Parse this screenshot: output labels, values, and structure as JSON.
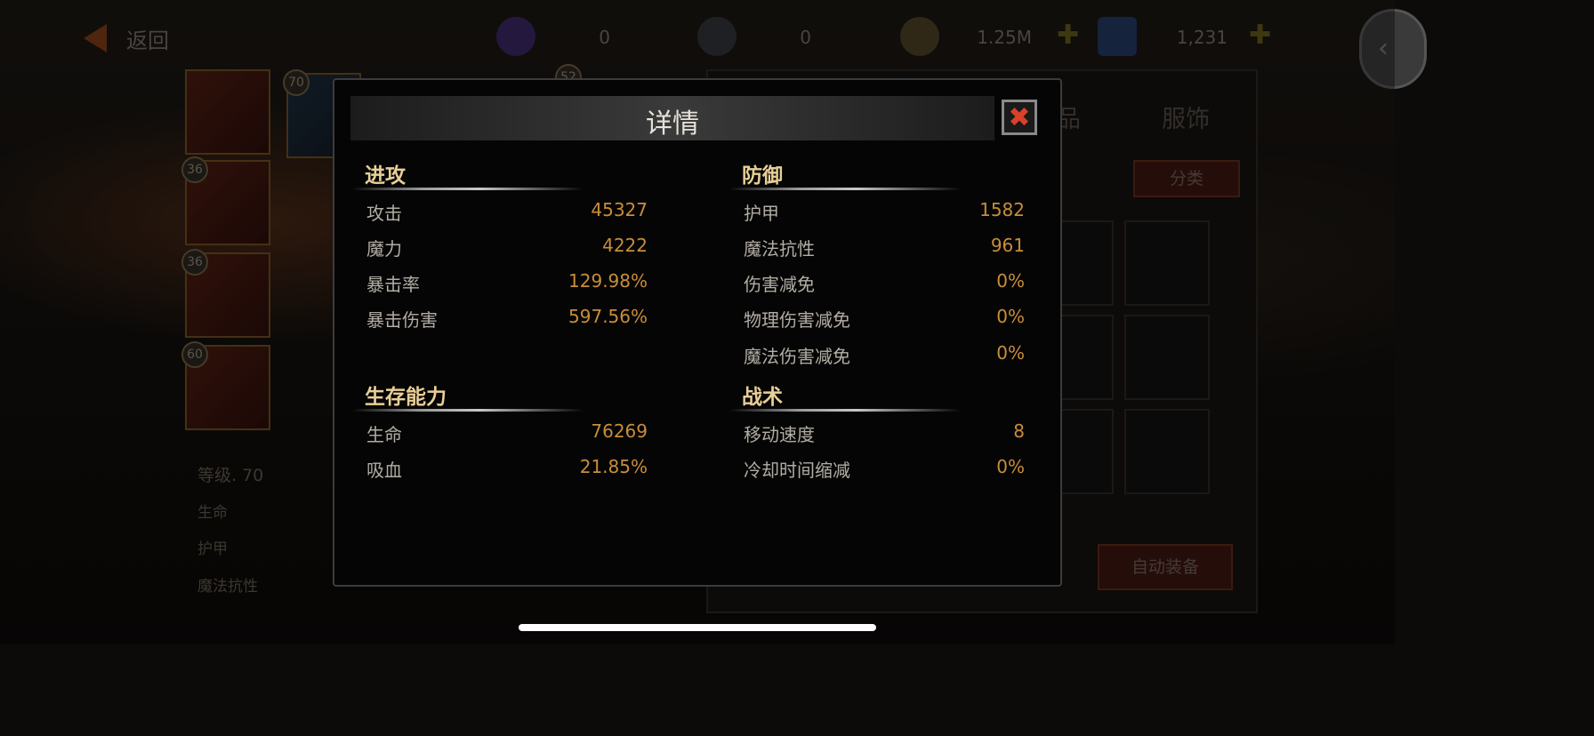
{
  "topbar": {
    "back_label": "返回",
    "resources": [
      {
        "name": "token-purple",
        "value": "0",
        "color": "#4a2a7a"
      },
      {
        "name": "token-dark",
        "value": "0",
        "color": "#3a4048"
      },
      {
        "name": "gold-coins",
        "value": "1.25M",
        "color": "#6a5a30"
      },
      {
        "name": "crystals",
        "value": "1,231",
        "color": "#2a4a8a"
      }
    ]
  },
  "background": {
    "hero_levels": [
      "70",
      "36",
      "36",
      "60",
      "52"
    ],
    "level_label": "等级. 70",
    "stat_labels": [
      "生命",
      "护甲",
      "魔法抗性"
    ],
    "tab_fragment": "品",
    "tab_outfit": "服饰",
    "sort_button": "分类",
    "auto_equip_button": "自动装备"
  },
  "dialog": {
    "title": "详情",
    "close_symbol": "✖",
    "sections": [
      {
        "id": "attack",
        "title": "进攻",
        "stats": [
          {
            "label": "攻击",
            "value": "45327"
          },
          {
            "label": "魔力",
            "value": "4222"
          },
          {
            "label": "暴击率",
            "value": "129.98%"
          },
          {
            "label": "暴击伤害",
            "value": "597.56%"
          }
        ]
      },
      {
        "id": "defense",
        "title": "防御",
        "stats": [
          {
            "label": "护甲",
            "value": "1582"
          },
          {
            "label": "魔法抗性",
            "value": "961"
          },
          {
            "label": "伤害减免",
            "value": "0%"
          },
          {
            "label": "物理伤害减免",
            "value": "0%"
          },
          {
            "label": "魔法伤害减免",
            "value": "0%"
          }
        ]
      },
      {
        "id": "survival",
        "title": "生存能力",
        "stats": [
          {
            "label": "生命",
            "value": "76269"
          },
          {
            "label": "吸血",
            "value": "21.85%"
          }
        ]
      },
      {
        "id": "tactics",
        "title": "战术",
        "stats": [
          {
            "label": "移动速度",
            "value": "8"
          },
          {
            "label": "冷却时间缩减",
            "value": "0%"
          }
        ]
      }
    ]
  },
  "colors": {
    "section_title": "#e8cf97",
    "stat_value": "#c98d3a",
    "close_x": "#d8412a"
  }
}
